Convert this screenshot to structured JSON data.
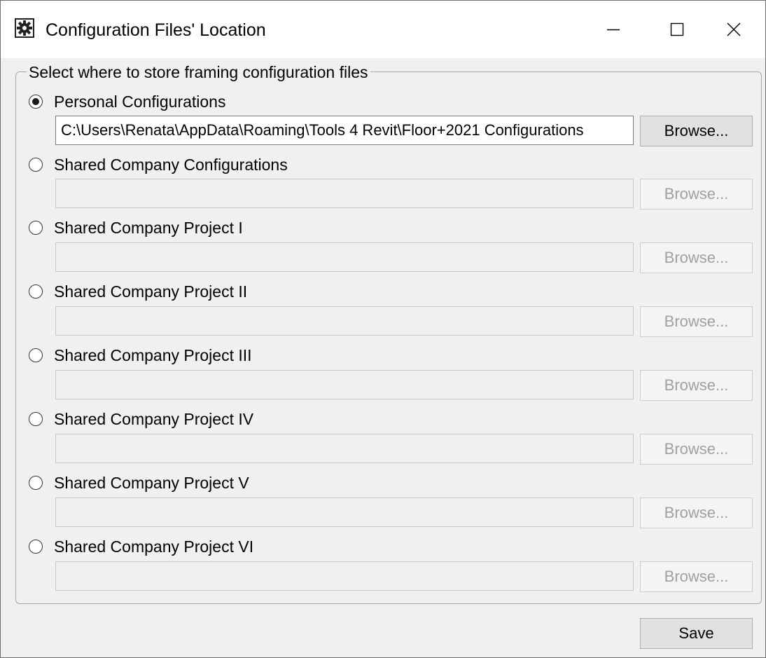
{
  "window": {
    "title": "Configuration Files' Location",
    "icon": "gear-document-icon",
    "controls": [
      "minimize-icon",
      "maximize-icon",
      "close-icon"
    ]
  },
  "group": {
    "legend": "Select where to store framing configuration files"
  },
  "options": [
    {
      "label": "Personal Configurations",
      "selected": true,
      "path": "C:\\Users\\Renata\\AppData\\Roaming\\Tools 4 Revit\\Floor+2021 Configurations",
      "enabled": true,
      "browse_label": "Browse..."
    },
    {
      "label": "Shared Company Configurations",
      "selected": false,
      "path": "",
      "enabled": false,
      "browse_label": "Browse..."
    },
    {
      "label": "Shared Company Project I",
      "selected": false,
      "path": "",
      "enabled": false,
      "browse_label": "Browse..."
    },
    {
      "label": "Shared Company Project II",
      "selected": false,
      "path": "",
      "enabled": false,
      "browse_label": "Browse..."
    },
    {
      "label": "Shared Company Project III",
      "selected": false,
      "path": "",
      "enabled": false,
      "browse_label": "Browse..."
    },
    {
      "label": "Shared Company Project IV",
      "selected": false,
      "path": "",
      "enabled": false,
      "browse_label": "Browse..."
    },
    {
      "label": "Shared Company Project V",
      "selected": false,
      "path": "",
      "enabled": false,
      "browse_label": "Browse..."
    },
    {
      "label": "Shared Company Project VI",
      "selected": false,
      "path": "",
      "enabled": false,
      "browse_label": "Browse..."
    }
  ],
  "footer": {
    "save_label": "Save"
  }
}
